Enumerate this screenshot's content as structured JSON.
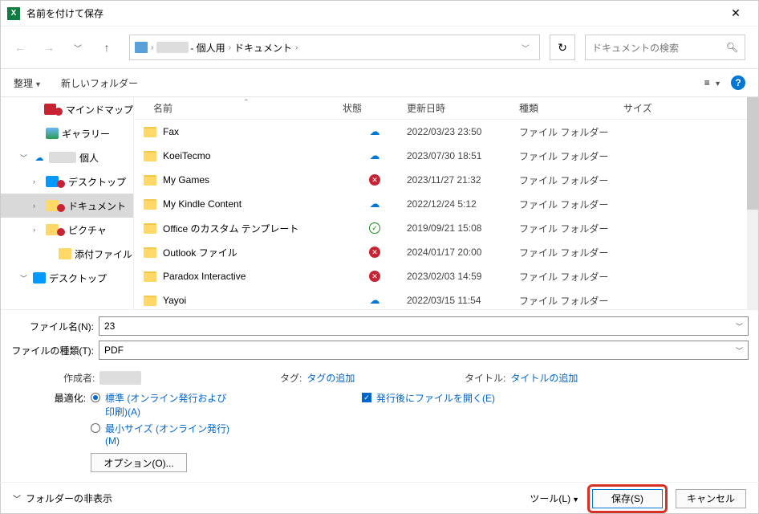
{
  "title": "名前を付けて保存",
  "breadcrumb": {
    "root_label": "- 個人用",
    "current": "ドキュメント"
  },
  "nav": {
    "refresh_tip": "refresh"
  },
  "search": {
    "placeholder": "ドキュメントの検索"
  },
  "toolbar": {
    "organize": "整理",
    "new_folder": "新しいフォルダー"
  },
  "tree": [
    {
      "label": "マインドマップ",
      "icon": "mind",
      "err": true,
      "indent": 2
    },
    {
      "label": "ギャラリー",
      "icon": "gallery",
      "indent": 2
    },
    {
      "label": "個人",
      "icon": "cloud",
      "chev": "down",
      "indent": 1,
      "redact_before": true
    },
    {
      "label": "デスクトップ",
      "icon": "desk",
      "err": true,
      "chev": "right",
      "indent": 2
    },
    {
      "label": "ドキュメント",
      "icon": "folder",
      "err": true,
      "chev": "right",
      "indent": 2,
      "selected": true
    },
    {
      "label": "ピクチャ",
      "icon": "folder",
      "err": true,
      "chev": "right",
      "indent": 2
    },
    {
      "label": "添付ファイル",
      "icon": "folder",
      "indent": 3
    },
    {
      "label": "デスクトップ",
      "icon": "desk",
      "chev": "down",
      "indent": 1
    }
  ],
  "columns": {
    "name": "名前",
    "state": "状態",
    "date": "更新日時",
    "type": "種類",
    "size": "サイズ"
  },
  "rows": [
    {
      "name": "Fax",
      "state": "cloud",
      "date": "2022/03/23 23:50",
      "type": "ファイル フォルダー"
    },
    {
      "name": "KoeiTecmo",
      "state": "cloud",
      "date": "2023/07/30 18:51",
      "type": "ファイル フォルダー"
    },
    {
      "name": "My Games",
      "state": "err",
      "date": "2023/11/27 21:32",
      "type": "ファイル フォルダー"
    },
    {
      "name": "My Kindle Content",
      "state": "cloud",
      "date": "2022/12/24 5:12",
      "type": "ファイル フォルダー"
    },
    {
      "name": "Office のカスタム テンプレート",
      "state": "ok",
      "date": "2019/09/21 15:08",
      "type": "ファイル フォルダー"
    },
    {
      "name": "Outlook ファイル",
      "state": "err",
      "date": "2024/01/17 20:00",
      "type": "ファイル フォルダー"
    },
    {
      "name": "Paradox Interactive",
      "state": "err",
      "date": "2023/02/03 14:59",
      "type": "ファイル フォルダー"
    },
    {
      "name": "Yayoi",
      "state": "cloud",
      "date": "2022/03/15 11:54",
      "type": "ファイル フォルダー"
    }
  ],
  "fields": {
    "filename_label": "ファイル名(N):",
    "filename_value": "23",
    "filetype_label": "ファイルの種類(T):",
    "filetype_value": "PDF"
  },
  "meta": {
    "author_label": "作成者:",
    "tag_label": "タグ:",
    "tag_link": "タグの追加",
    "title_label": "タイトル:",
    "title_link": "タイトルの追加"
  },
  "optimize": {
    "label": "最適化:",
    "standard": "標準 (オンライン発行および印刷)(A)",
    "minsize": "最小サイズ (オンライン発行)(M)",
    "open_after": "発行後にファイルを開く(E)",
    "options_btn": "オプション(O)..."
  },
  "footer": {
    "hide_folders": "フォルダーの非表示",
    "tools": "ツール(L)",
    "save": "保存(S)",
    "cancel": "キャンセル"
  }
}
